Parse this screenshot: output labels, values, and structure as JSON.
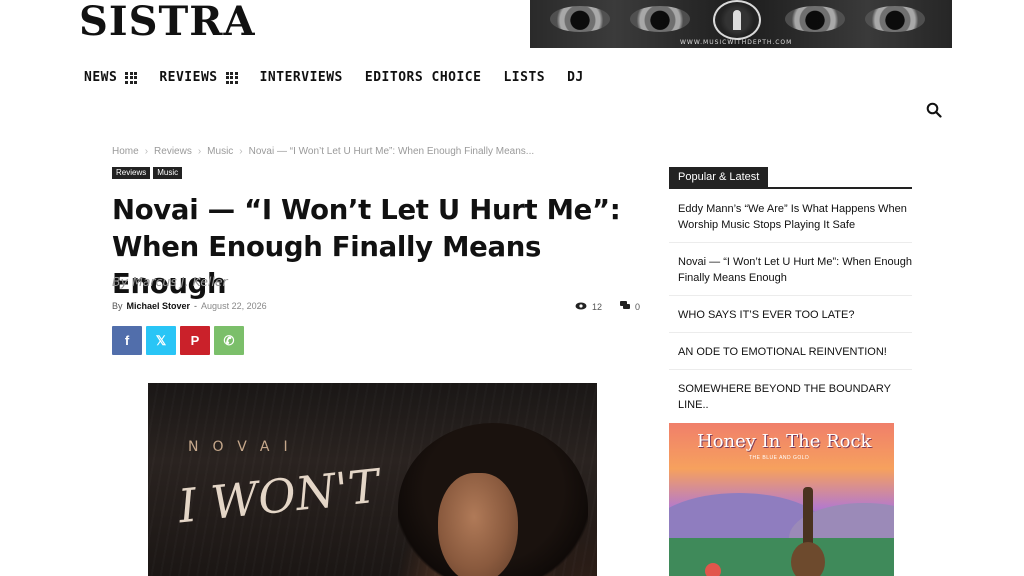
{
  "site": {
    "logo": "SISTRA"
  },
  "banner": {
    "url_text": "WWW.MUSICWITHDEPTH.COM"
  },
  "nav": {
    "items": [
      {
        "label": "NEWS",
        "has_grid": true
      },
      {
        "label": "REVIEWS",
        "has_grid": true
      },
      {
        "label": "INTERVIEWS",
        "has_grid": false
      },
      {
        "label": "EDITORS CHOICE",
        "has_grid": false
      },
      {
        "label": "LISTS",
        "has_grid": false
      },
      {
        "label": "DJ",
        "has_grid": false
      }
    ]
  },
  "breadcrumb": [
    "Home",
    "Reviews",
    "Music",
    "Novai — “I Won’t Let U Hurt Me”: When Enough Finally Means..."
  ],
  "breadcrumb_sep": "›",
  "tags": [
    "Reviews",
    "Music"
  ],
  "article": {
    "title": "Novai — “I Won’t Let U Hurt Me”: When Enough Finally Means Enough",
    "byline_italic": "By Marcus J. Keller",
    "by_label": "By",
    "author": "Michael Stover",
    "dash": "-",
    "date": "August 22, 2026",
    "views": "12",
    "comments": "0"
  },
  "share": {
    "facebook_glyph": "f",
    "twitter_glyph": "𝕏",
    "pinterest_glyph": "P",
    "whatsapp_glyph": "✆"
  },
  "hero": {
    "artist_text": "NOVAI",
    "script_text": "I WON'T"
  },
  "sidebar": {
    "heading": "Popular & Latest",
    "items": [
      "Eddy Mann’s “We Are” Is What Happens When Worship Music Stops Playing It Safe",
      "Novai — “I Won’t Let U Hurt Me”: When Enough Finally Means Enough",
      "WHO SAYS IT’S EVER TOO LATE?",
      "AN ODE TO EMOTIONAL REINVENTION!",
      "SOMEWHERE BEYOND THE BOUNDARY LINE.."
    ]
  },
  "ad": {
    "title": "Honey In The Rock",
    "subtitle": "THE BLUE AND GOLD"
  },
  "colors": {
    "facebook": "#516eab",
    "twitter": "#29c5f6",
    "pinterest": "#ca212a",
    "whatsapp": "#7bbf6a",
    "tag_bg": "#222222"
  },
  "icons": {
    "search": "search-icon",
    "views": "eye-icon",
    "comments": "comment-icon",
    "nav_grid": "grid-icon"
  }
}
